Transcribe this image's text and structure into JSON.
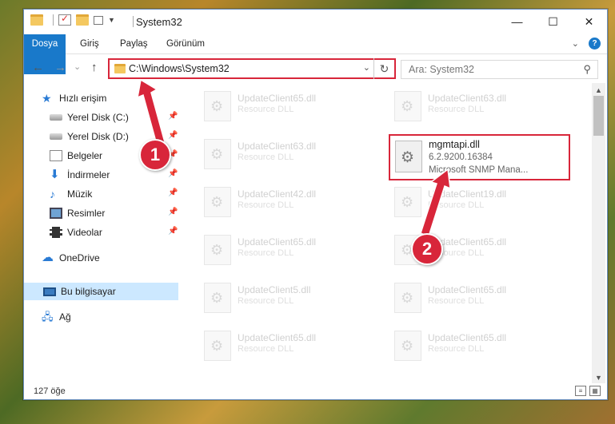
{
  "window": {
    "title": "System32",
    "controls": {
      "minimize": "—",
      "maximize": "☐",
      "close": "✕"
    }
  },
  "ribbon": {
    "tabs": [
      "Dosya",
      "Giriş",
      "Paylaş",
      "Görünüm"
    ],
    "expand_icon": "chevron-down-icon",
    "help": "?"
  },
  "address": {
    "back": "←",
    "forward": "→",
    "recent": "⌄",
    "up": "↑",
    "path": "C:\\Windows\\System32",
    "dropdown": "⌄",
    "refresh": "↻"
  },
  "search": {
    "placeholder": "Ara: System32",
    "icon": "search-icon"
  },
  "nav": {
    "items": [
      {
        "label": "Hızlı erişim",
        "icon": "star-icon"
      },
      {
        "label": "Yerel Disk (C:)",
        "icon": "disk-icon",
        "pinned": true
      },
      {
        "label": "Yerel Disk (D:)",
        "icon": "disk-icon",
        "pinned": true
      },
      {
        "label": "Belgeler",
        "icon": "documents-icon",
        "pinned": true
      },
      {
        "label": "İndirmeler",
        "icon": "download-icon",
        "pinned": true
      },
      {
        "label": "Müzik",
        "icon": "music-icon",
        "pinned": true
      },
      {
        "label": "Resimler",
        "icon": "pictures-icon",
        "pinned": true
      },
      {
        "label": "Videolar",
        "icon": "videos-icon",
        "pinned": true
      },
      {
        "label": "OneDrive",
        "icon": "cloud-icon"
      },
      {
        "label": "Bu bilgisayar",
        "icon": "pc-icon",
        "selected": true
      },
      {
        "label": "Ağ",
        "icon": "network-icon"
      }
    ],
    "pin_glyph": "📌"
  },
  "files": [
    {
      "name": "UpdateClient65.dll",
      "desc": "Resource DLL"
    },
    {
      "name": "UpdateClient63.dll",
      "desc": "Resource DLL"
    },
    {
      "name": "UpdateClient63.dll",
      "desc": "Resource DLL"
    },
    {
      "name": "UpdateClient42.dll",
      "desc": "Resource DLL"
    },
    {
      "name": "UpdateClient19.dll",
      "desc": "Resource DLL"
    },
    {
      "name": "UpdateClient65.dll",
      "desc": "Resource DLL"
    },
    {
      "name": "UpdateClient65.dll",
      "desc": "Resource DLL"
    },
    {
      "name": "UpdateClient5.dll",
      "desc": "Resource DLL"
    },
    {
      "name": "UpdateClient65.dll",
      "desc": "Resource DLL"
    },
    {
      "name": "UpdateClient65.dll",
      "desc": "Resource DLL"
    },
    {
      "name": "UpdateClient65.dll",
      "desc": "Resource DLL"
    }
  ],
  "highlighted_file": {
    "name": "mgmtapi.dll",
    "version": "6.2.9200.16384",
    "description": "Microsoft SNMP Mana..."
  },
  "status": {
    "count": "127 öğe"
  },
  "callouts": {
    "one": "1",
    "two": "2",
    "color": "#d8263a"
  }
}
